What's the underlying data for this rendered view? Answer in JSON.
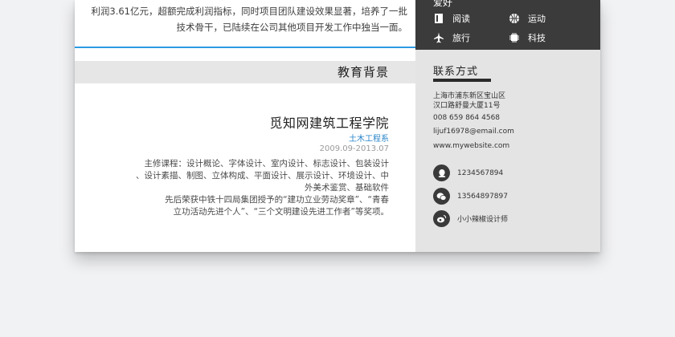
{
  "experience_tail": {
    "line1": "利润3.61亿元，超额完成利润指标，同时项目团队建设效果显著，培养了一批",
    "line2": "技术骨干，已陆续在公司其他项目开发工作中独当一面。"
  },
  "education": {
    "section_title": "教育背景",
    "school": "觅知网建筑工程学院",
    "major": "土木工程系",
    "dates": "2009.09-2013.07",
    "desc_lines": [
      "主修课程：设计概论、字体设计、室内设计、标志设计、包装设计",
      "、设计素描、制图、立体构成、平面设计、展示设计、环境设计、中",
      "外美术鉴赏、基础软件",
      "先后荣获中铁十四局集团授予的“建功立业劳动奖章”、“青春",
      "立功活动先进个人”、“三个文明建设先进工作者”等奖项。"
    ]
  },
  "sidebar": {
    "hobbies_title": "爱好",
    "hobbies": [
      {
        "label": "阅读",
        "icon": "book-icon"
      },
      {
        "label": "运动",
        "icon": "basketball-icon"
      },
      {
        "label": "旅行",
        "icon": "airplane-icon"
      },
      {
        "label": "科技",
        "icon": "chip-icon"
      }
    ],
    "contact_title": "联系方式",
    "address_line1": "上海市浦东新区宝山区",
    "address_line2": "汉口路舒曼大厦11号",
    "phone": "008 659 864 4568",
    "email": "lijuf16978@email.com",
    "website": "www.mywebsite.com",
    "qq": "1234567894",
    "wechat": "13564897897",
    "weibo": "小小辣椒设计师"
  },
  "colors": {
    "accent": "#2a9ae3",
    "sidebar_dark": "#3b3b3b",
    "sidebar_light": "#e4e4e4"
  }
}
